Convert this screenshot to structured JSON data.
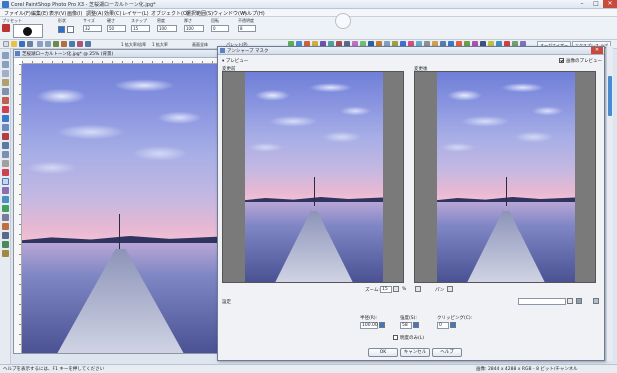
{
  "app": {
    "title": "Corel PaintShop Photo Pro X3 - 芝桜湖ローカルトーン化.jpg*",
    "window_controls": [
      "–",
      "□",
      "✕"
    ]
  },
  "menu": [
    "ファイル(F)",
    "編集(E)",
    "表示(V)",
    "画像(I)",
    "調整(A)",
    "効果(C)",
    "レイヤー(L)",
    "オブジェクト(O)",
    "選択範囲(S)",
    "ウィンドウ(W)",
    "ヘルプ(H)"
  ],
  "options": {
    "preset_label": "プリセット",
    "shape_label": "形状",
    "size_label": "サイズ",
    "size_value": "32",
    "hardness_label": "硬さ",
    "hardness_value": "50",
    "step_label": "ステップ",
    "step_value": "15",
    "density_label": "密度",
    "density_value": "100",
    "thickness_label": "厚さ",
    "thickness_value": "100",
    "rotation_label": "回転",
    "rotation_value": "0",
    "opacity_label": "不透明度",
    "opacity_value": "8"
  },
  "toolbar2": {
    "zoom_label": "1 拡大率/倍率",
    "zoom_fit_label": "1 拡大率",
    "fit_label": "画面全体",
    "palette_label": "パレット(P)",
    "organizer_tab": "オーガナイザー",
    "express_lab_tab": "エクスプレス ラボ"
  },
  "image_window": {
    "title": "芝桜湖ローカルトーン化.jpg* @ 25% (背景)"
  },
  "dialog": {
    "title": "アンシャープ マスク",
    "preview_label": "▾ プレビュー",
    "show_preview_label": "画像のプレビュー",
    "before_label": "変更前",
    "after_label": "変更後",
    "zoom_label": "ズーム:",
    "zoom_value": "15",
    "zoom_unit": "%",
    "pan_label": "パン",
    "settings_label": "設定",
    "radius_label": "半径(R):",
    "radius_value": "100.00",
    "strength_label": "強度(S):",
    "strength_value": "58",
    "clipping_label": "クリッピング(C):",
    "clipping_value": "0",
    "luminance_label": "明度のみ(L)",
    "ok_label": "OK",
    "cancel_label": "キャンセル",
    "help_label": "ヘルプ"
  },
  "status": {
    "left": "ヘルプを表示するには、F1 キーを押してください",
    "right": "画像: 2844 x 4288 x RGB - 8 ビット/チャンネル"
  },
  "colors": {
    "close_red": "#c94a3a",
    "accent_blue": "#3a78c8"
  }
}
